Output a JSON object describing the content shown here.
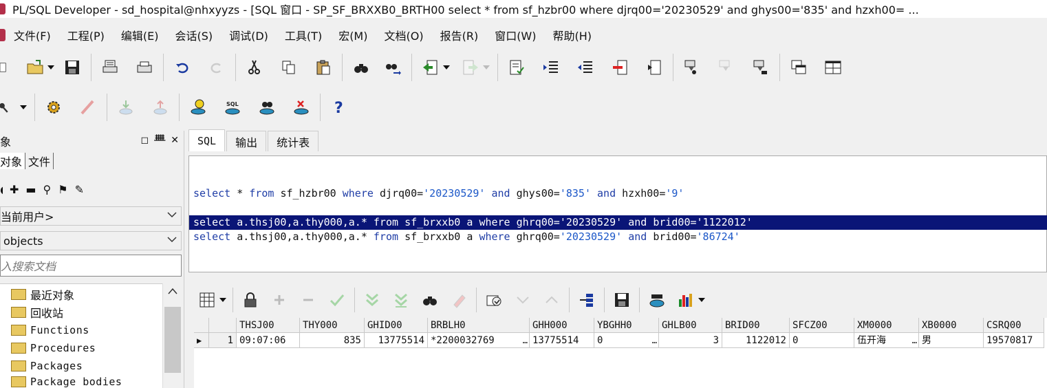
{
  "window": {
    "title": "PL/SQL Developer - sd_hospital@nhxyyzs - [SQL 窗口 - SP_SF_BRXXB0_BRTH00 select * from sf_hzbr00 where djrq00='20230529' and ghys00='835' and hzxh00= ..."
  },
  "menu": [
    "文件(F)",
    "工程(P)",
    "编辑(E)",
    "会话(S)",
    "调试(D)",
    "工具(T)",
    "宏(M)",
    "文档(O)",
    "报告(R)",
    "窗口(W)",
    "帮助(H)"
  ],
  "left_panel": {
    "header": "象",
    "tabs": [
      "对象",
      "文件"
    ],
    "user_combo": "当前用户>",
    "objects_combo": "objects",
    "search_placeholder": "入搜索文档",
    "tree": [
      "最近对象",
      "回收站",
      "Functions",
      "Procedures",
      "Packages",
      "Package bodies"
    ]
  },
  "sql_tabs": [
    "SQL",
    "输出",
    "统计表"
  ],
  "editor": {
    "lines": [
      {
        "parts": [
          [
            "kw",
            "select "
          ],
          [
            "plain",
            "* "
          ],
          [
            "kw",
            "from "
          ],
          [
            "plain",
            "sf_hzbr00 "
          ],
          [
            "kw",
            "where "
          ],
          [
            "plain",
            "djrq00="
          ],
          [
            "str",
            "'20230529' "
          ],
          [
            "kw",
            "and "
          ],
          [
            "plain",
            "ghys00="
          ],
          [
            "str",
            "'835' "
          ],
          [
            "kw",
            "and "
          ],
          [
            "plain",
            "hzxh00="
          ],
          [
            "str",
            "'9'"
          ]
        ]
      },
      {
        "parts": [
          [
            "kw",
            "select "
          ],
          [
            "plain",
            "a.thsj00,a.thy000,a.* "
          ],
          [
            "kw",
            "from "
          ],
          [
            "plain",
            "sf_brxxb0 a "
          ],
          [
            "kw",
            "where "
          ],
          [
            "plain",
            "ghrq00="
          ],
          [
            "str",
            "'20230529' "
          ],
          [
            "kw",
            "and "
          ],
          [
            "plain",
            "brid00="
          ],
          [
            "str",
            "'1122012'"
          ]
        ]
      },
      {
        "parts": [
          [
            "kw",
            "select "
          ],
          [
            "plain",
            "a.thsj00,a.thy000,a.* "
          ],
          [
            "kw",
            "from "
          ],
          [
            "plain",
            "sf_brxxb0 a "
          ],
          [
            "kw",
            "where "
          ],
          [
            "plain",
            "ghrq00="
          ],
          [
            "str",
            "'20230529' "
          ],
          [
            "kw",
            "and "
          ],
          [
            "plain",
            "brid00="
          ],
          [
            "str",
            "'86724'"
          ]
        ]
      }
    ]
  },
  "grid": {
    "columns": [
      "THSJ00",
      "THY000",
      "GHID00",
      "BRBLH0",
      "GHH000",
      "YBGHH0",
      "GHLB00",
      "BRID00",
      "SFCZ00",
      "XM0000",
      "XB0000",
      "CSRQ00"
    ],
    "rows": [
      {
        "num": "1",
        "cells": [
          "09:07:06",
          "835",
          "13775514",
          "*2200032769",
          "13775514",
          "0",
          "3",
          "1122012",
          "0",
          "伍开海",
          "男",
          "19570817"
        ]
      }
    ]
  },
  "colors": {
    "selection": "#0a1577",
    "keyword": "#1f3da6",
    "string": "#1b57c8"
  }
}
